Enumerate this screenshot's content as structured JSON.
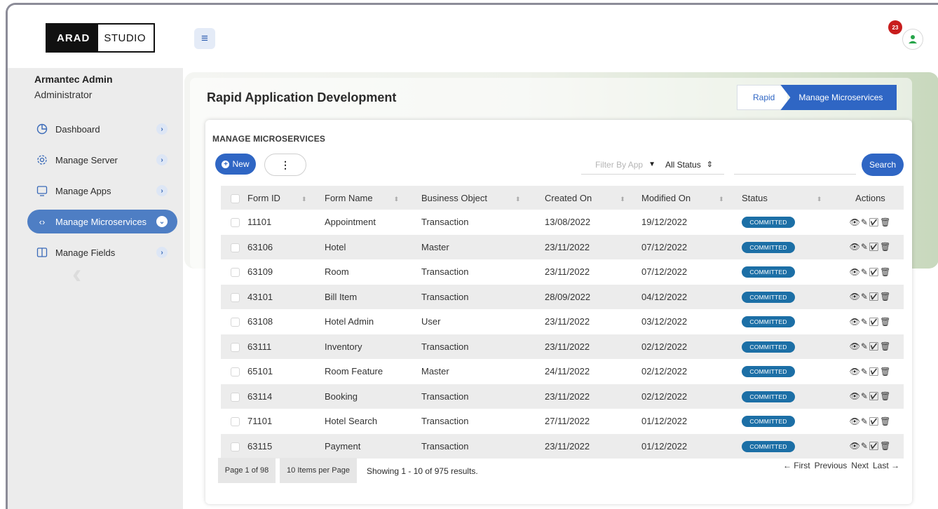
{
  "brand": {
    "dark": "ARAD",
    "light": "STUDIO"
  },
  "topbar": {
    "notifications": "23"
  },
  "user": {
    "name": "Armantec Admin",
    "role": "Administrator"
  },
  "nav": [
    {
      "label": "Dashboard",
      "icon": "pie-chart-icon"
    },
    {
      "label": "Manage Server",
      "icon": "gear-icon"
    },
    {
      "label": "Manage Apps",
      "icon": "monitor-icon"
    },
    {
      "label": "Manage Microservices",
      "icon": "code-icon",
      "active": true
    },
    {
      "label": "Manage Fields",
      "icon": "columns-icon"
    }
  ],
  "page": {
    "title": "Rapid Application Development"
  },
  "breadcrumb": {
    "first": "Rapid",
    "current": "Manage Microservices"
  },
  "card": {
    "title": "MANAGE MICROSERVICES",
    "new_label": "New",
    "more_label": "⋮",
    "filter_app_placeholder": "Filter By App",
    "filter_status": "All Status",
    "search_label": "Search"
  },
  "table": {
    "headers": [
      "Form ID",
      "Form Name",
      "Business Object",
      "Created On",
      "Modified On",
      "Status",
      "Actions"
    ],
    "rows": [
      {
        "id": "11101",
        "name": "Appointment",
        "object": "Transaction",
        "created": "13/08/2022",
        "modified": "19/12/2022",
        "status": "COMMITTED"
      },
      {
        "id": "63106",
        "name": "Hotel",
        "object": "Master",
        "created": "23/11/2022",
        "modified": "07/12/2022",
        "status": "COMMITTED"
      },
      {
        "id": "63109",
        "name": "Room",
        "object": "Transaction",
        "created": "23/11/2022",
        "modified": "07/12/2022",
        "status": "COMMITTED"
      },
      {
        "id": "43101",
        "name": "Bill Item",
        "object": "Transaction",
        "created": "28/09/2022",
        "modified": "04/12/2022",
        "status": "COMMITTED"
      },
      {
        "id": "63108",
        "name": "Hotel Admin",
        "object": "User",
        "created": "23/11/2022",
        "modified": "03/12/2022",
        "status": "COMMITTED"
      },
      {
        "id": "63111",
        "name": "Inventory",
        "object": "Transaction",
        "created": "23/11/2022",
        "modified": "02/12/2022",
        "status": "COMMITTED"
      },
      {
        "id": "65101",
        "name": "Room Feature",
        "object": "Master",
        "created": "24/11/2022",
        "modified": "02/12/2022",
        "status": "COMMITTED"
      },
      {
        "id": "63114",
        "name": "Booking",
        "object": "Transaction",
        "created": "23/11/2022",
        "modified": "02/12/2022",
        "status": "COMMITTED"
      },
      {
        "id": "71101",
        "name": "Hotel Search",
        "object": "Transaction",
        "created": "27/11/2022",
        "modified": "01/12/2022",
        "status": "COMMITTED"
      },
      {
        "id": "63115",
        "name": "Payment",
        "object": "Transaction",
        "created": "23/11/2022",
        "modified": "01/12/2022",
        "status": "COMMITTED"
      }
    ]
  },
  "pagination": {
    "page": "Page 1 of 98",
    "per_page": "10 Items per Page",
    "showing": "Showing 1 - 10 of 975 results.",
    "first": "← First",
    "previous": "Previous",
    "next": "Next",
    "last": "Last →"
  },
  "colors": {
    "accent": "#2f66c4",
    "badge": "#1c6fa6",
    "active_nav": "#4e7ec4"
  }
}
